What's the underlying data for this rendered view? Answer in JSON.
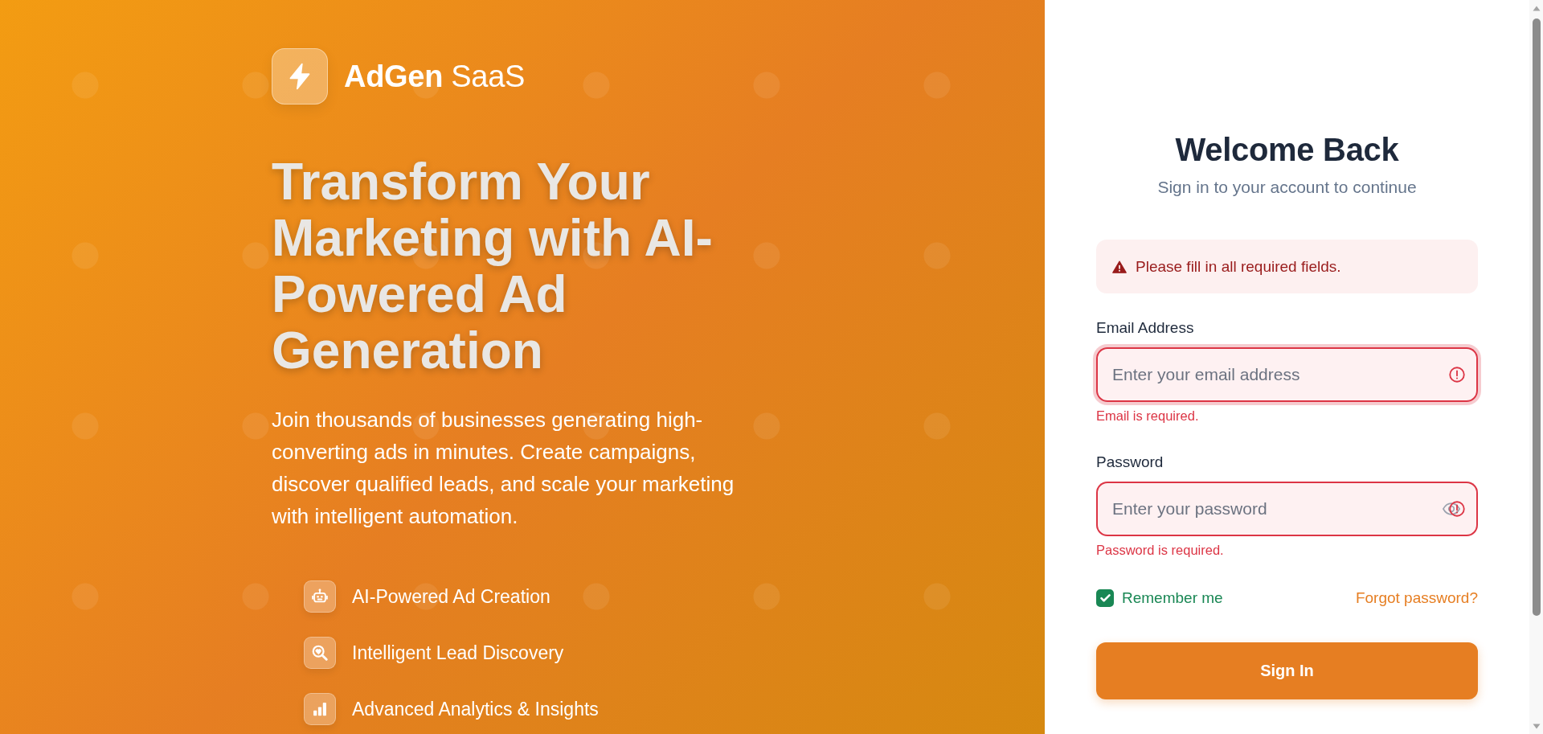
{
  "brand": {
    "name": "**AdGen** SaaS"
  },
  "hero": {
    "headline": "Transform Your Marketing with AI-Powered Ad Generation",
    "description": "Join thousands of businesses generating high-converting ads in minutes. Create campaigns, discover qualified leads, and scale your marketing with intelligent automation.",
    "features": [
      {
        "kind": "creation",
        "label": "AI-Powered Ad Creation"
      },
      {
        "kind": "discovery",
        "label": "Intelligent Lead Discovery"
      },
      {
        "kind": "analytics",
        "label": "Advanced Analytics & Insights"
      }
    ]
  },
  "login": {
    "title": "Welcome Back",
    "subtitle": "Sign in to your account to continue",
    "alert": {
      "message": "Please fill in all required fields."
    },
    "fields": [
      {
        "kind": "email",
        "label": "Email Address",
        "placeholder": "Enter your email address",
        "invalid": true,
        "focused": true,
        "error": "Email is required."
      },
      {
        "kind": "password",
        "label": "Password",
        "placeholder": "Enter your password",
        "invalid": true,
        "focused": false,
        "error": "Password is required."
      }
    ],
    "remember": {
      "label": "Remember me",
      "checked": true
    },
    "forgot_link": "Forgot password?",
    "submit": "Sign In"
  }
}
